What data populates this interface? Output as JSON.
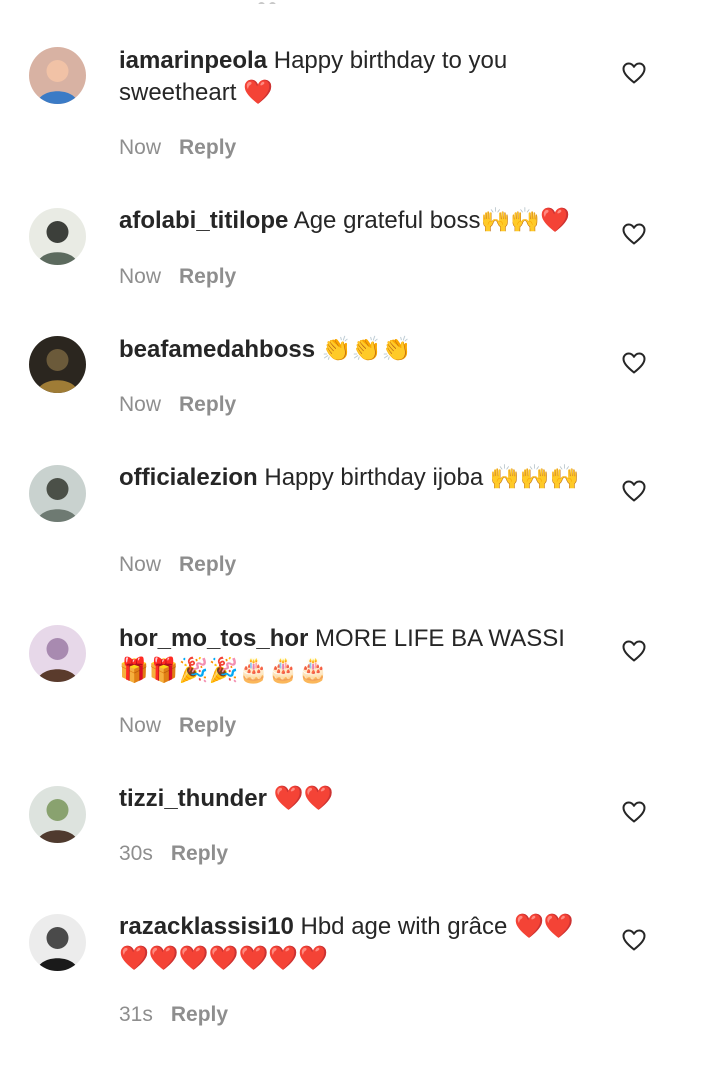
{
  "comments": [
    {
      "username": "iamarinpeola",
      "text": "Happy birthday to you sweetheart ❤️",
      "time": "Now",
      "reply": "Reply",
      "avatar_colors": [
        "#d8b2a3",
        "#3b7bc6",
        "#f1c2a6"
      ]
    },
    {
      "username": "afolabi_titilope",
      "text": "Age grateful boss🙌🙌❤️",
      "time": "Now",
      "reply": "Reply",
      "avatar_colors": [
        "#e9ebe4",
        "#5c6a5e",
        "#3c3f3a"
      ]
    },
    {
      "username": "beafamedahboss",
      "text": "👏👏👏",
      "time": "Now",
      "reply": "Reply",
      "avatar_colors": [
        "#2b261f",
        "#9f7c36",
        "#6b5a3a"
      ]
    },
    {
      "username": "officialezion",
      "text": "Happy birthday ijoba 🙌🙌🙌",
      "time": "Now",
      "reply": "Reply",
      "avatar_colors": [
        "#c9d2cf",
        "#6e7a72",
        "#4b5048"
      ]
    },
    {
      "username": "hor_mo_tos_hor",
      "text": "MORE LIFE BA WASSI🎁🎁🎉🎉🎂🎂🎂",
      "time": "Now",
      "reply": "Reply",
      "avatar_colors": [
        "#e7d8e9",
        "#5a3b2c",
        "#a88ab0"
      ]
    },
    {
      "username": "tizzi_thunder",
      "text": "❤️❤️",
      "time": "30s",
      "reply": "Reply",
      "avatar_colors": [
        "#dde3de",
        "#4f3a2e",
        "#89a26f"
      ]
    },
    {
      "username": "razacklassisi10",
      "text": "Hbd age with grâce ❤️❤️❤️❤️❤️❤️❤️❤️❤️",
      "time": "31s",
      "reply": "Reply",
      "avatar_colors": [
        "#ececec",
        "#1a1a1a",
        "#4a4a4a"
      ]
    }
  ],
  "colors": {
    "text": "#262626",
    "secondary": "#8e8e8e",
    "heart_outline": "#262626"
  },
  "icons": {
    "like": "heart-outline-icon"
  }
}
